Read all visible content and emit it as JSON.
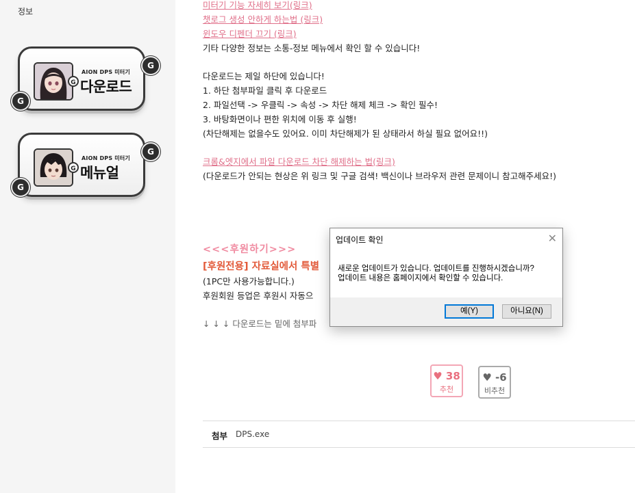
{
  "sidebar": {
    "title": "정보",
    "banners": [
      {
        "sub": "AION DPS 미터기",
        "label": "다운로드"
      },
      {
        "sub": "AION DPS 미터기",
        "label": "메뉴얼"
      }
    ],
    "coin_glyph": "G"
  },
  "content": {
    "link1": "미터기 기능 자세히 보기(링크)",
    "link2": "챗로그 생성 안하게 하는법 (링크)",
    "link3": "윈도우 디펜더 끄기 (링크)",
    "info_text": "기타 다양한 정보는 소통-정보 메뉴에서 확인 할 수 있습니다!",
    "download_intro": "다운로드는 제일 하단에 있습니다!",
    "step1": "1. 하단 첨부파일 클릭 후 다운로드",
    "step2": "2. 파일선택 -> 우클릭 -> 속성 -> 차단 해제 체크 -> 확인 필수!",
    "step3": "3. 바탕화면이나 편한 위치에 이동 후 실행!",
    "note": "(차단해제는 없을수도 있어요. 이미 차단해제가 된 상태라서 하실 필요 없어요!!)",
    "chrome_link": "크롬&엣지에서 파일 다운로드 차단 해제하는 법(링크)",
    "chrome_note": "(다운로드가 안되는 현상은 위 링크 및 구글 검색! 백신이나 브라우저 관련 문제이니 참고해주세요!)",
    "sponsor_title": "<<<후원하기>>>",
    "sponsor_heading": "[후원전용] 자료실에서 특별",
    "sponsor_pc": "(1PC만 사용가능합니다.)",
    "sponsor_member": "후원회원 등업은 후원시 자동으",
    "download_below": "↓ ↓ ↓  다운로드는 밑에 첨부파"
  },
  "votes": {
    "up": {
      "count": "38",
      "label": "추천"
    },
    "down": {
      "count": "-6",
      "label": "비추천"
    }
  },
  "attachment": {
    "label": "첨부",
    "file": "DPS.exe"
  },
  "dialog": {
    "title": "업데이트 확인",
    "message_line1": "새로운 업데이트가 있습니다. 업데이트를 진행하시겠습니까?",
    "message_line2": "업데이트 내용은 홈페이지에서 확인할 수 있습니다.",
    "yes_label": "예(Y)",
    "no_label": "아니요(N)",
    "close_glyph": "✕"
  }
}
